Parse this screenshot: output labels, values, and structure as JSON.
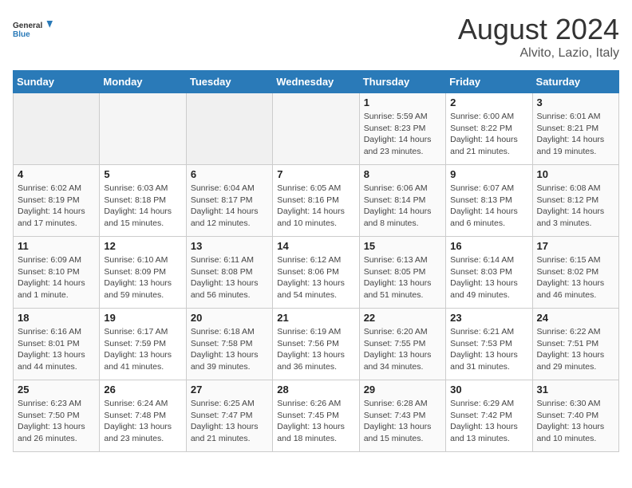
{
  "header": {
    "logo_general": "General",
    "logo_blue": "Blue",
    "month_year": "August 2024",
    "location": "Alvito, Lazio, Italy"
  },
  "days_of_week": [
    "Sunday",
    "Monday",
    "Tuesday",
    "Wednesday",
    "Thursday",
    "Friday",
    "Saturday"
  ],
  "weeks": [
    [
      {
        "day": "",
        "empty": true
      },
      {
        "day": "",
        "empty": true
      },
      {
        "day": "",
        "empty": true
      },
      {
        "day": "",
        "empty": true
      },
      {
        "day": "1",
        "sunrise": "5:59 AM",
        "sunset": "8:23 PM",
        "daylight": "14 hours and 23 minutes."
      },
      {
        "day": "2",
        "sunrise": "6:00 AM",
        "sunset": "8:22 PM",
        "daylight": "14 hours and 21 minutes."
      },
      {
        "day": "3",
        "sunrise": "6:01 AM",
        "sunset": "8:21 PM",
        "daylight": "14 hours and 19 minutes."
      }
    ],
    [
      {
        "day": "4",
        "sunrise": "6:02 AM",
        "sunset": "8:19 PM",
        "daylight": "14 hours and 17 minutes."
      },
      {
        "day": "5",
        "sunrise": "6:03 AM",
        "sunset": "8:18 PM",
        "daylight": "14 hours and 15 minutes."
      },
      {
        "day": "6",
        "sunrise": "6:04 AM",
        "sunset": "8:17 PM",
        "daylight": "14 hours and 12 minutes."
      },
      {
        "day": "7",
        "sunrise": "6:05 AM",
        "sunset": "8:16 PM",
        "daylight": "14 hours and 10 minutes."
      },
      {
        "day": "8",
        "sunrise": "6:06 AM",
        "sunset": "8:14 PM",
        "daylight": "14 hours and 8 minutes."
      },
      {
        "day": "9",
        "sunrise": "6:07 AM",
        "sunset": "8:13 PM",
        "daylight": "14 hours and 6 minutes."
      },
      {
        "day": "10",
        "sunrise": "6:08 AM",
        "sunset": "8:12 PM",
        "daylight": "14 hours and 3 minutes."
      }
    ],
    [
      {
        "day": "11",
        "sunrise": "6:09 AM",
        "sunset": "8:10 PM",
        "daylight": "14 hours and 1 minute."
      },
      {
        "day": "12",
        "sunrise": "6:10 AM",
        "sunset": "8:09 PM",
        "daylight": "13 hours and 59 minutes."
      },
      {
        "day": "13",
        "sunrise": "6:11 AM",
        "sunset": "8:08 PM",
        "daylight": "13 hours and 56 minutes."
      },
      {
        "day": "14",
        "sunrise": "6:12 AM",
        "sunset": "8:06 PM",
        "daylight": "13 hours and 54 minutes."
      },
      {
        "day": "15",
        "sunrise": "6:13 AM",
        "sunset": "8:05 PM",
        "daylight": "13 hours and 51 minutes."
      },
      {
        "day": "16",
        "sunrise": "6:14 AM",
        "sunset": "8:03 PM",
        "daylight": "13 hours and 49 minutes."
      },
      {
        "day": "17",
        "sunrise": "6:15 AM",
        "sunset": "8:02 PM",
        "daylight": "13 hours and 46 minutes."
      }
    ],
    [
      {
        "day": "18",
        "sunrise": "6:16 AM",
        "sunset": "8:01 PM",
        "daylight": "13 hours and 44 minutes."
      },
      {
        "day": "19",
        "sunrise": "6:17 AM",
        "sunset": "7:59 PM",
        "daylight": "13 hours and 41 minutes."
      },
      {
        "day": "20",
        "sunrise": "6:18 AM",
        "sunset": "7:58 PM",
        "daylight": "13 hours and 39 minutes."
      },
      {
        "day": "21",
        "sunrise": "6:19 AM",
        "sunset": "7:56 PM",
        "daylight": "13 hours and 36 minutes."
      },
      {
        "day": "22",
        "sunrise": "6:20 AM",
        "sunset": "7:55 PM",
        "daylight": "13 hours and 34 minutes."
      },
      {
        "day": "23",
        "sunrise": "6:21 AM",
        "sunset": "7:53 PM",
        "daylight": "13 hours and 31 minutes."
      },
      {
        "day": "24",
        "sunrise": "6:22 AM",
        "sunset": "7:51 PM",
        "daylight": "13 hours and 29 minutes."
      }
    ],
    [
      {
        "day": "25",
        "sunrise": "6:23 AM",
        "sunset": "7:50 PM",
        "daylight": "13 hours and 26 minutes."
      },
      {
        "day": "26",
        "sunrise": "6:24 AM",
        "sunset": "7:48 PM",
        "daylight": "13 hours and 23 minutes."
      },
      {
        "day": "27",
        "sunrise": "6:25 AM",
        "sunset": "7:47 PM",
        "daylight": "13 hours and 21 minutes."
      },
      {
        "day": "28",
        "sunrise": "6:26 AM",
        "sunset": "7:45 PM",
        "daylight": "13 hours and 18 minutes."
      },
      {
        "day": "29",
        "sunrise": "6:28 AM",
        "sunset": "7:43 PM",
        "daylight": "13 hours and 15 minutes."
      },
      {
        "day": "30",
        "sunrise": "6:29 AM",
        "sunset": "7:42 PM",
        "daylight": "13 hours and 13 minutes."
      },
      {
        "day": "31",
        "sunrise": "6:30 AM",
        "sunset": "7:40 PM",
        "daylight": "13 hours and 10 minutes."
      }
    ]
  ],
  "labels": {
    "sunrise_prefix": "Sunrise: ",
    "sunset_prefix": "Sunset: ",
    "daylight_prefix": "Daylight: "
  }
}
